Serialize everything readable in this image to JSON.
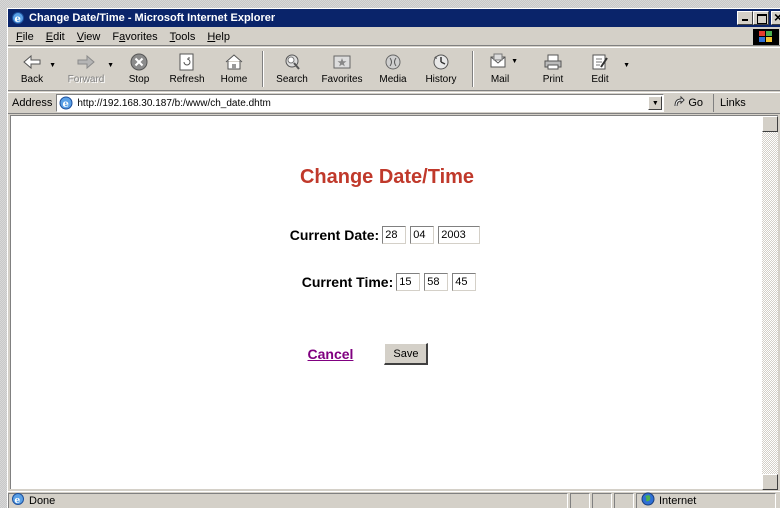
{
  "window": {
    "title": "Change Date/Time - Microsoft Internet Explorer",
    "title_bar_color": "#0a246a"
  },
  "menu": [
    {
      "key": "F",
      "rest": "ile"
    },
    {
      "key": "E",
      "rest": "dit"
    },
    {
      "key": "V",
      "rest": "iew"
    },
    {
      "key": "",
      "pre": "F",
      "key2": "a",
      "rest": "vorites"
    },
    {
      "key": "T",
      "rest": "ools"
    },
    {
      "key": "H",
      "rest": "elp"
    }
  ],
  "toolbar": {
    "back": "Back",
    "forward": "Forward",
    "stop": "Stop",
    "refresh": "Refresh",
    "home": "Home",
    "search": "Search",
    "favorites": "Favorites",
    "media": "Media",
    "history": "History",
    "mail": "Mail",
    "print": "Print",
    "edit": "Edit"
  },
  "address": {
    "label": "Address",
    "url": "http://192.168.30.187/b:/www/ch_date.dhtm",
    "go": "Go",
    "links": "Links"
  },
  "page": {
    "title": "Change Date/Time",
    "title_color": "#c0392b",
    "date_label": "Current Date:",
    "date_day": "28",
    "date_month": "04",
    "date_year": "2003",
    "time_label": "Current Time:",
    "time_hour": "15",
    "time_minute": "58",
    "time_second": "45",
    "cancel": "Cancel",
    "save": "Save"
  },
  "status": {
    "text": "Done",
    "zone": "Internet"
  }
}
